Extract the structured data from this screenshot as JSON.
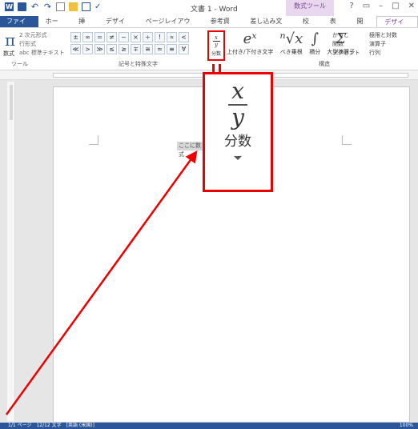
{
  "titlebar": {
    "title": "文書 1 - Word",
    "context_tab": "数式ツール",
    "help": "?",
    "restore": "▭",
    "minimize": "–",
    "maximize": "□",
    "close": "✕"
  },
  "tabs": [
    {
      "label": "ファイル"
    },
    {
      "label": "ホーム"
    },
    {
      "label": "挿入"
    },
    {
      "label": "デザイン"
    },
    {
      "label": "ページレイアウト"
    },
    {
      "label": "参考資料"
    },
    {
      "label": "差し込み文書"
    },
    {
      "label": "校閲"
    },
    {
      "label": "表示"
    },
    {
      "label": "開発"
    },
    {
      "label": "デザイン"
    }
  ],
  "ribbon": {
    "equation_label": "数式",
    "tools": [
      "2 次元形式",
      "行形式",
      "abc 標準テキスト"
    ],
    "tools_group": "ツール",
    "symbols_group": "記号と特殊文字",
    "symbols": [
      "±",
      "∞",
      "=",
      "≠",
      "~",
      "×",
      "÷",
      "!",
      "∝",
      "<",
      "≪",
      ">",
      "≫",
      "≤",
      "≥",
      "∓",
      "≅",
      "≈",
      "≡",
      "∀"
    ],
    "fraction_label": "分数",
    "structures": [
      {
        "glyph": "eˣ",
        "label": "上付き/下付き文字"
      },
      {
        "glyph": "ⁿ√x",
        "label": "べき乗根"
      },
      {
        "glyph": "∫",
        "label": "積分"
      },
      {
        "glyph": "Σ",
        "label": "大型演算子"
      }
    ],
    "structures_group": "構造",
    "right_tools": [
      "かっこ",
      "関数",
      "アクセント"
    ],
    "right_tools2": [
      "極限と対数",
      "演算子",
      "行列"
    ]
  },
  "document": {
    "placeholder": "ここに数式"
  },
  "callout": {
    "x": "x",
    "y": "y",
    "label": "分数"
  },
  "statusbar": {
    "left": "1/1 ページ　12/12 文字　[英語 (米国)]",
    "zoom": "100%"
  },
  "colors": {
    "accent": "#2b579a",
    "highlight": "#e00000",
    "context_tab": "#7b3f8f"
  }
}
